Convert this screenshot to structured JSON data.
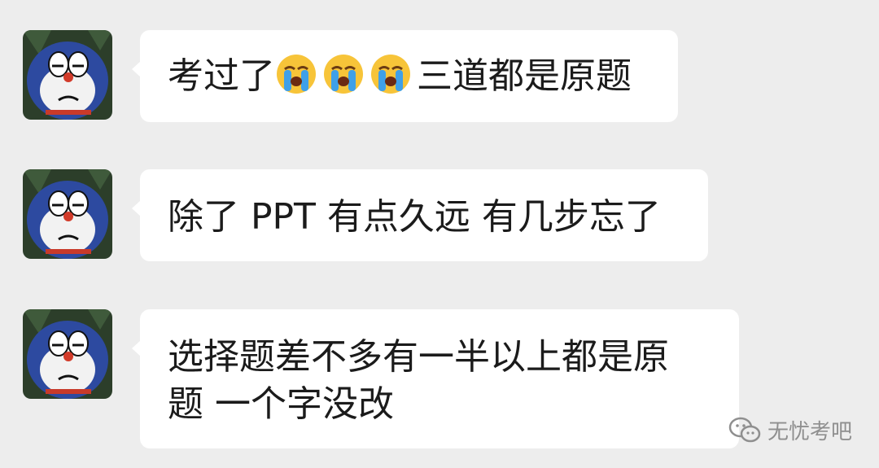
{
  "messages": [
    {
      "before_emoji": "考过了",
      "emoji": [
        "loudly-crying-face",
        "loudly-crying-face",
        "loudly-crying-face"
      ],
      "after_emoji": "三道都是原题"
    },
    {
      "text": "除了 PPT 有点久远 有几步忘了"
    },
    {
      "line1": "选择题差不多有一半以上都是原",
      "line2": "题 一个字没改"
    }
  ],
  "watermark": {
    "icon": "wechat-icon",
    "text": "无忧考吧"
  },
  "colors": {
    "background": "#ededed",
    "bubble": "#ffffff",
    "text": "#1b1b1b",
    "watermark": "#8f8f8f"
  }
}
